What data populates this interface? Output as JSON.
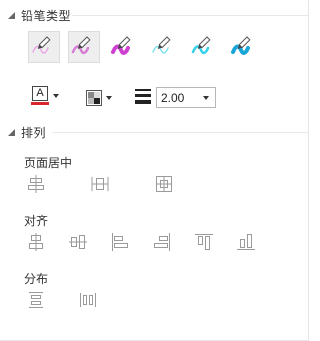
{
  "pen_section": {
    "title": "铅笔类型",
    "pens": [
      {
        "icon": "pencil-pink-thin-icon",
        "color": "#e7a6e7"
      },
      {
        "icon": "pencil-pink-medium-icon",
        "color": "#d77ed7"
      },
      {
        "icon": "pencil-magenta-thick-icon",
        "color": "#d040d0"
      },
      {
        "icon": "pencil-cyan-thin-icon",
        "color": "#7fe3f1"
      },
      {
        "icon": "pencil-cyan-medium-icon",
        "color": "#35d2ea"
      },
      {
        "icon": "pencil-blue-thick-icon",
        "color": "#1aa6d6"
      }
    ],
    "selected_index": 0
  },
  "style_tools": {
    "font_color_glyph": "A",
    "font_color": "#d9262d",
    "fill_icon": "fill-pattern-icon",
    "line_width_icon": "line-width-icon",
    "line_width_value": "2.00"
  },
  "arrange_section": {
    "title": "排列",
    "page_center": {
      "label": "页面居中",
      "icons": [
        "center-horizontal-icon",
        "center-vertical-icon",
        "center-both-icon"
      ]
    },
    "align": {
      "label": "对齐",
      "icons": [
        "align-center-icon",
        "align-middle-icon",
        "align-left-icon",
        "align-right-icon",
        "align-top-icon",
        "align-bottom-icon"
      ]
    },
    "distribute": {
      "label": "分布",
      "icons": [
        "distribute-vertical-icon",
        "distribute-horizontal-icon"
      ]
    }
  }
}
